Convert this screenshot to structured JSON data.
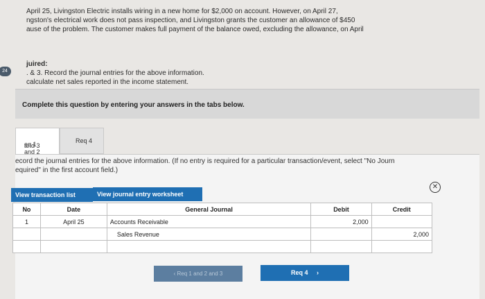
{
  "problem": {
    "line1": "April 25, Livingston Electric installs wiring in a new home for $2,000 on account. However, on April 27,",
    "line2": "ngston's electrical work does not pass inspection, and Livingston grants the customer an allowance of $450",
    "line3": "ause of the problem. The customer makes full payment of the balance owed, excluding the allowance, on April"
  },
  "page_badge": "24",
  "required": {
    "heading": "juired:",
    "item1": ". & 3. Record the journal entries for the above information.",
    "item2": "calculate net sales reported in the income statement."
  },
  "complete_text": "Complete this question by entering your answers in the tabs below.",
  "tabs": [
    {
      "label_line1": "eq 1 and 2",
      "label_line2": "and 3",
      "active": true
    },
    {
      "label": "Req 4",
      "active": false
    }
  ],
  "instructions": {
    "line1": "ecord the journal entries for the above information. (If no entry is required for a particular transaction/event, select \"No Journ",
    "line2": "equired\" in the first account field.)"
  },
  "buttons": {
    "view_transaction_list": "View transaction list",
    "view_journal_worksheet": "View journal entry worksheet",
    "prev": "Req 1 and 2 and 3",
    "next": "Req 4"
  },
  "journal": {
    "headers": {
      "no": "No",
      "date": "Date",
      "general_journal": "General Journal",
      "debit": "Debit",
      "credit": "Credit"
    },
    "rows": [
      {
        "no": "1",
        "date": "April 25",
        "account": "Accounts Receivable",
        "debit": "2,000",
        "credit": ""
      },
      {
        "no": "",
        "date": "",
        "account": "Sales Revenue",
        "debit": "",
        "credit": "2,000"
      },
      {
        "no": "",
        "date": "",
        "account": "",
        "debit": "",
        "credit": ""
      }
    ]
  }
}
